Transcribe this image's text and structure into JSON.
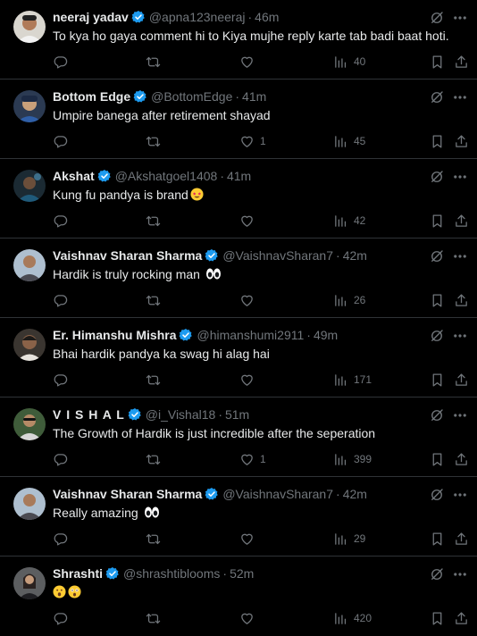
{
  "colors": {
    "background": "#000000",
    "text": "#e7e9ea",
    "muted": "#71767b",
    "divider": "#2f3336",
    "verified": "#1d9bf0"
  },
  "icons": {
    "reply": "reply-icon",
    "retweet": "retweet-icon",
    "like": "heart-icon",
    "views": "views-icon",
    "bookmark": "bookmark-icon",
    "share": "share-icon",
    "grok": "grok-icon",
    "more": "more-icon",
    "verified": "verified-badge-icon"
  },
  "tweets": [
    {
      "name": "neeraj yadav",
      "handle": "@apna123neeraj",
      "sep": "·",
      "time": "46m",
      "text": "To kya ho gaya comment hi to Kiya mujhe reply karte tab badi baat hoti.",
      "likes": "",
      "views": "40"
    },
    {
      "name": "Bottom Edge",
      "handle": "@BottomEdge",
      "sep": "·",
      "time": "41m",
      "text": "Umpire banega after retirement shayad",
      "likes": "1",
      "views": "45"
    },
    {
      "name": "Akshat",
      "handle": "@Akshatgoel1408",
      "sep": "·",
      "time": "41m",
      "text": "Kung fu pandya is brand",
      "likes": "",
      "views": "42"
    },
    {
      "name": "Vaishnav Sharan Sharma",
      "handle": "@VaishnavSharan7",
      "sep": "·",
      "time": "42m",
      "text": "Hardik is truly rocking man",
      "likes": "",
      "views": "26"
    },
    {
      "name": "Er. Himanshu Mishra",
      "handle": "@himanshumi2911",
      "sep": "·",
      "time": "49m",
      "text": "Bhai hardik pandya ka swag hi alag hai",
      "likes": "",
      "views": "171"
    },
    {
      "name": "V I S H A L",
      "handle": "@i_Vishal18",
      "sep": "·",
      "time": "51m",
      "text": "The Growth of Hardik is just incredible after the seperation",
      "likes": "1",
      "views": "399"
    },
    {
      "name": "Vaishnav Sharan Sharma",
      "handle": "@VaishnavSharan7",
      "sep": "·",
      "time": "42m",
      "text": "Really amazing",
      "likes": "",
      "views": "29"
    },
    {
      "name": "Shrashti",
      "handle": "@shrashtiblooms",
      "sep": "·",
      "time": "52m",
      "text": "",
      "likes": "",
      "views": "420"
    }
  ]
}
